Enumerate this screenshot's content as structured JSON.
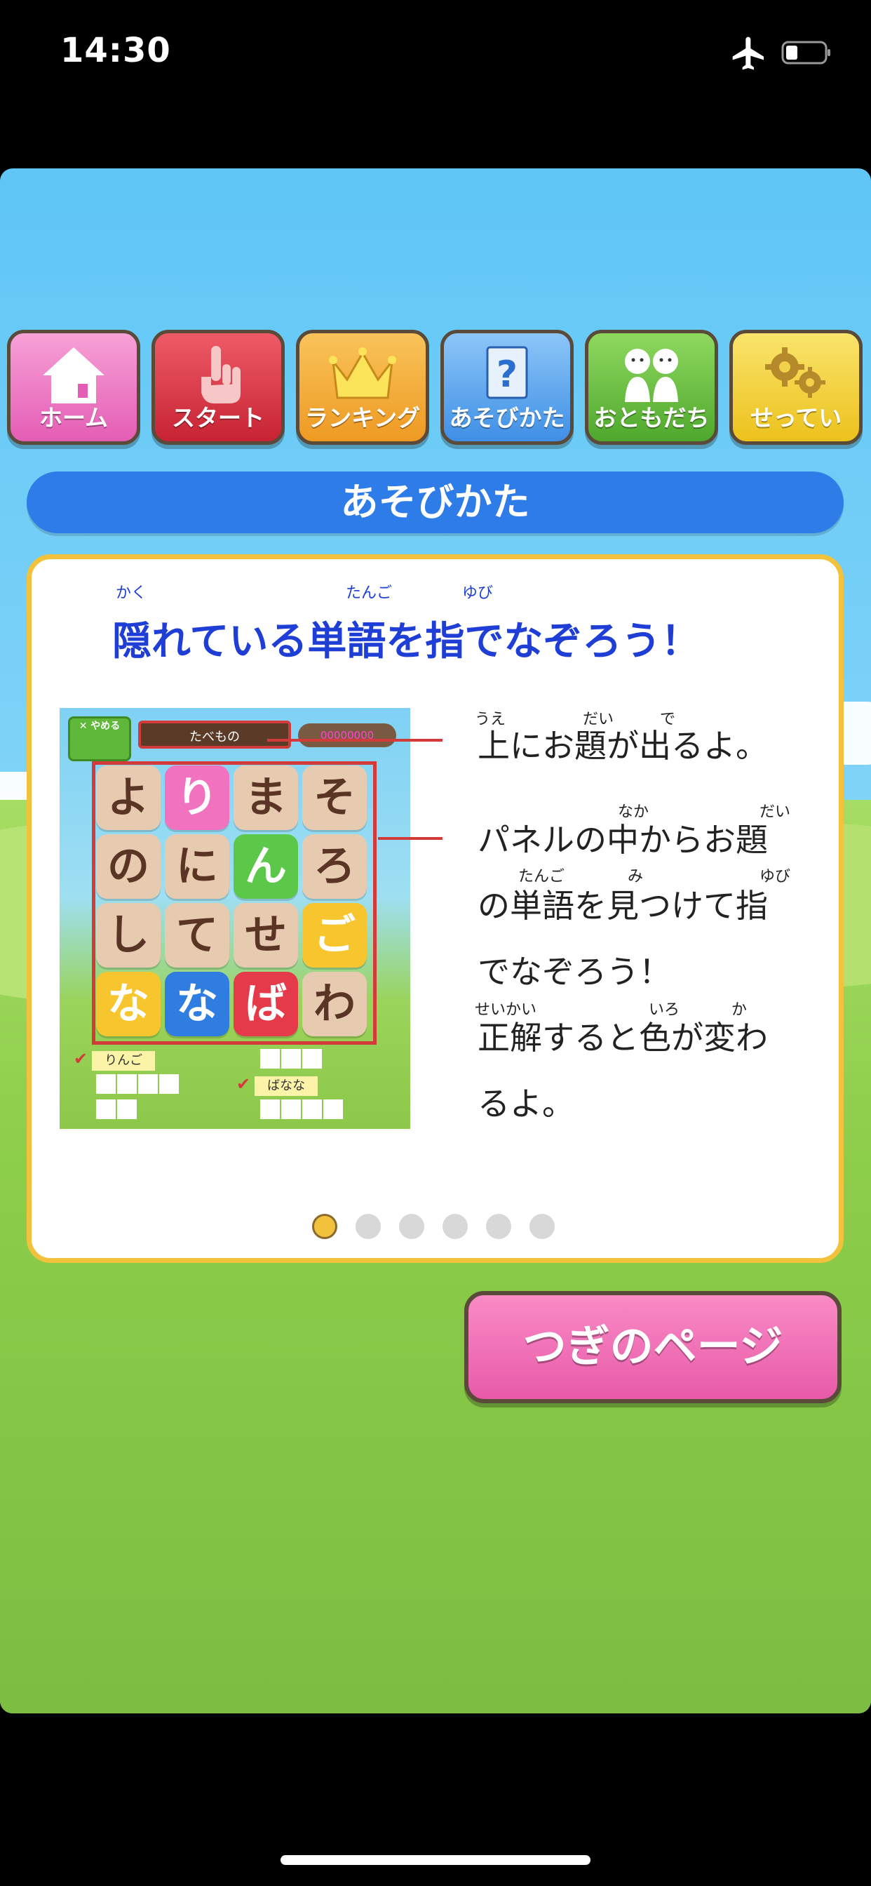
{
  "status": {
    "time": "14:30",
    "airplane_icon": "airplane-icon",
    "battery_icon": "battery-icon"
  },
  "nav": {
    "items": [
      {
        "label": "ホーム",
        "icon": "home-icon",
        "color": "#e85fb8"
      },
      {
        "label": "スタート",
        "icon": "pointer-hand-icon",
        "color": "#d8323d"
      },
      {
        "label": "ランキング",
        "icon": "crown-icon",
        "color": "#f0a22a"
      },
      {
        "label": "あそびかた",
        "icon": "question-icon",
        "color": "#3f8fe6"
      },
      {
        "label": "おともだち",
        "icon": "friends-icon",
        "color": "#5cb83a"
      },
      {
        "label": "せってい",
        "icon": "gear-icon",
        "color": "#f0c92a"
      }
    ]
  },
  "title": "あそびかた",
  "card": {
    "headline": "隠れている単語を指でなぞろう！",
    "headline_ruby": {
      "kaku": "かく",
      "tango": "たんご",
      "yubi": "ゆび"
    },
    "demo": {
      "quit_label": "✕ やめる",
      "category": "たべもの",
      "score": "00000000",
      "tiles": [
        "よ",
        "り",
        "ま",
        "そ",
        "の",
        "に",
        "ん",
        "ろ",
        "し",
        "て",
        "せ",
        "ご",
        "な",
        "な",
        "ば",
        "わ"
      ],
      "answers": [
        {
          "text": "りんご",
          "found": true
        },
        {
          "text": "",
          "found": false
        },
        {
          "text": "",
          "found": false
        },
        {
          "text": "ばなな",
          "found": true
        },
        {
          "text": "",
          "found": false
        },
        {
          "text": "",
          "found": false
        }
      ]
    },
    "desc": {
      "line1": "上にお題が出るよ。",
      "line2a": "パネルの中からお題",
      "line2b": "の単語を見つけて指",
      "line2c": "でなぞろう！",
      "line3a": "正解すると色が変わ",
      "line3b": "るよ。",
      "ruby": {
        "ue": "うえ",
        "dai1": "だい",
        "de": "で",
        "naka": "なか",
        "dai2": "だい",
        "tango": "たんご",
        "mi": "み",
        "yubi": "ゆび",
        "seikai": "せいかい",
        "iro": "いろ",
        "ka": "か"
      }
    },
    "page_indicator": {
      "total": 6,
      "current": 1
    }
  },
  "next_button": "つぎのページ"
}
